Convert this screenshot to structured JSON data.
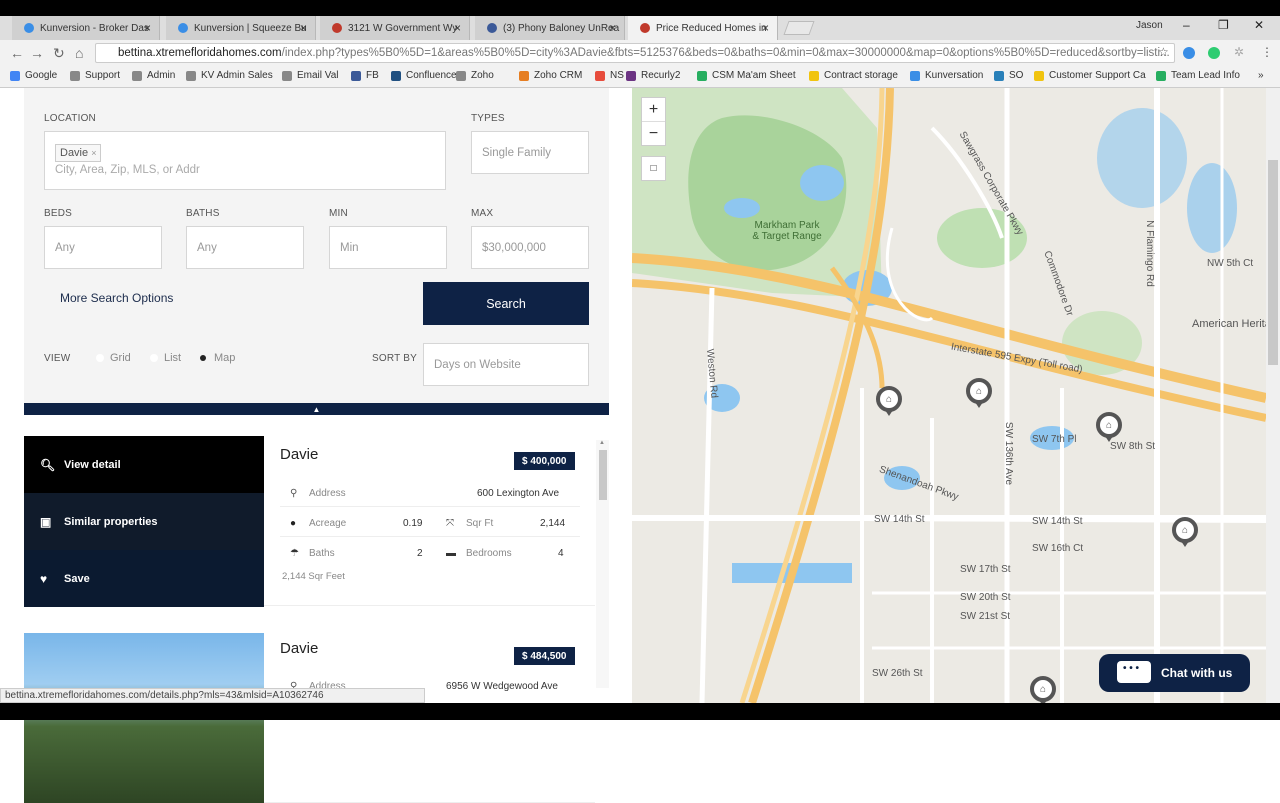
{
  "browser": {
    "tabs": [
      {
        "title": "Kunversion - Broker Das",
        "favicon_color": "#3a8ee6"
      },
      {
        "title": "Kunversion | Squeeze Bu",
        "favicon_color": "#3a8ee6"
      },
      {
        "title": "3121 W Government Wy",
        "favicon_color": "#c0392b"
      },
      {
        "title": "(3) Phony Baloney UnRea",
        "favicon_color": "#3b5998"
      },
      {
        "title": "Price Reduced Homes in",
        "favicon_color": "#c0392b"
      }
    ],
    "user": "Jason",
    "url_host": "bettina.xtremefloridahomes.com",
    "url_rest": "/index.php?types%5B0%5D=1&areas%5B0%5D=city%3ADavie&fbts=5125376&beds=0&baths=0&min=0&max=30000000&map=0&options%5B0%5D=reduced&sortby=listi...",
    "bookmarks": [
      {
        "label": "Google",
        "color": "#4285f4"
      },
      {
        "label": "Support",
        "color": "#888"
      },
      {
        "label": "Admin",
        "color": "#888"
      },
      {
        "label": "KV Admin Sales",
        "color": "#888"
      },
      {
        "label": "Email Val",
        "color": "#888"
      },
      {
        "label": "FB",
        "color": "#3b5998"
      },
      {
        "label": "Confluence",
        "color": "#205081"
      },
      {
        "label": "Zoho",
        "color": "#888"
      },
      {
        "label": "Zoho CRM",
        "color": "#e67e22"
      },
      {
        "label": "NS",
        "color": "#e74c3c"
      },
      {
        "label": "Recurly2",
        "color": "#6c3483"
      },
      {
        "label": "CSM Ma'am Sheet",
        "color": "#27ae60"
      },
      {
        "label": "Contract storage",
        "color": "#f1c40f"
      },
      {
        "label": "Kunversation",
        "color": "#3a8ee6"
      },
      {
        "label": "SO",
        "color": "#2980b9"
      },
      {
        "label": "Customer Support Ca",
        "color": "#f1c40f"
      },
      {
        "label": "Team Lead Info",
        "color": "#27ae60"
      }
    ],
    "status_url": "bettina.xtremefloridahomes.com/details.php?mls=43&mlsid=A10362746"
  },
  "filters": {
    "location_label": "LOCATION",
    "location_chip": "Davie",
    "location_placeholder": "City, Area, Zip, MLS, or Addr",
    "types_label": "TYPES",
    "types_value": "Single Family",
    "beds_label": "BEDS",
    "beds_value": "Any",
    "baths_label": "BATHS",
    "baths_value": "Any",
    "min_label": "MIN",
    "min_value": "Min",
    "max_label": "MAX",
    "max_value": "$30,000,000",
    "more_options": "More Search Options",
    "search_button": "Search",
    "view_label": "VIEW",
    "view_options": [
      "Grid",
      "List",
      "Map"
    ],
    "view_selected": "Map",
    "sort_label": "SORT BY",
    "sort_value": "Days on Website"
  },
  "listings": [
    {
      "city": "Davie",
      "price": "$ 400,000",
      "address_label": "Address",
      "address": "600 Lexington Ave",
      "acreage_label": "Acreage",
      "acreage": "0.19",
      "sqft_label": "Sqr Ft",
      "sqft": "2,144",
      "baths_label": "Baths",
      "baths": "2",
      "beds_label": "Bedrooms",
      "beds": "4",
      "note": "2,144 Sqr Feet",
      "actions": [
        "View detail",
        "Similar properties",
        "Save"
      ]
    },
    {
      "city": "Davie",
      "price": "$ 484,500",
      "address_label": "Address",
      "address": "6956 W Wedgewood Ave"
    }
  ],
  "map": {
    "zoom_in": "+",
    "zoom_out": "−",
    "labels": [
      "Markham Park & Target Range",
      "Interstate 595 Expy (Toll road)",
      "American Heritage Scho",
      "SW 14th St",
      "SW 17th St",
      "SW 20th St",
      "SW 21st St",
      "SW 26th St",
      "N Flamingo Rd",
      "Commodore Dr",
      "Weston Rd",
      "Shenandoah Pkwy",
      "Sawgrass Corporate Pkwy",
      "NW 5th Ct",
      "SW 8th St",
      "SW 7th Pl",
      "SW 14th St",
      "SW 16th Ct",
      "SW 136th Ave"
    ]
  },
  "chat": {
    "label": "Chat with us"
  }
}
